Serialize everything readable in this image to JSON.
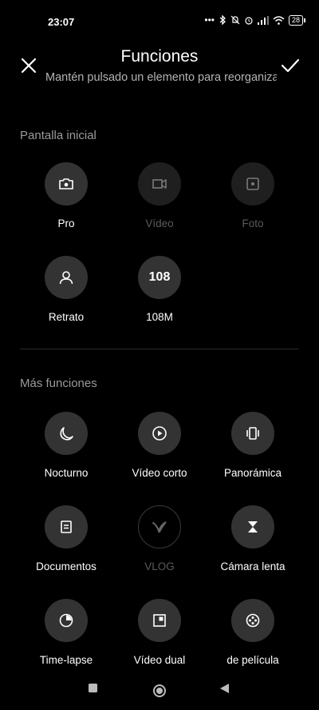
{
  "status_bar": {
    "time": "23:07",
    "dots": "•••",
    "signal_icon": "signal-icon",
    "wifi_icon": "wifi-icon",
    "battery": "28"
  },
  "header": {
    "title": "Funciones",
    "subtitle": "Mantén pulsado un elemento para reorganizar",
    "close_icon": "close-icon",
    "confirm_icon": "check-icon"
  },
  "home_section": {
    "label": "Pantalla inicial",
    "items": [
      {
        "label": "Pro",
        "icon": "camera-icon",
        "enabled": true
      },
      {
        "label": "Vídeo",
        "icon": "video-camera-icon",
        "enabled": false
      },
      {
        "label": "Foto",
        "icon": "photo-shutter-icon",
        "enabled": false
      },
      {
        "label": "Retrato",
        "icon": "person-icon",
        "enabled": true
      },
      {
        "label": "108M",
        "icon": "108-text-icon",
        "icon_text": "108",
        "enabled": true
      }
    ]
  },
  "more_section": {
    "label": "Más funciones",
    "items": [
      {
        "label": "Nocturno",
        "icon": "moon-icon",
        "enabled": true
      },
      {
        "label": "Vídeo corto",
        "icon": "play-circle-icon",
        "enabled": true
      },
      {
        "label": "Panorámica",
        "icon": "panorama-icon",
        "enabled": true
      },
      {
        "label": "Documentos",
        "icon": "document-icon",
        "enabled": true
      },
      {
        "label": "VLOG",
        "icon": "vlog-icon",
        "enabled": false
      },
      {
        "label": "Cámara lenta",
        "icon": "hourglass-icon",
        "enabled": true
      },
      {
        "label": "Time-lapse",
        "icon": "timer-icon",
        "enabled": true
      },
      {
        "label": "Vídeo dual",
        "icon": "dual-video-icon",
        "enabled": true
      },
      {
        "label": "de película",
        "icon": "film-reel-icon",
        "enabled": true
      }
    ]
  },
  "nav_bar": {
    "recent_icon": "square-icon",
    "home_icon": "circle-home-icon",
    "back_icon": "triangle-back-icon"
  }
}
